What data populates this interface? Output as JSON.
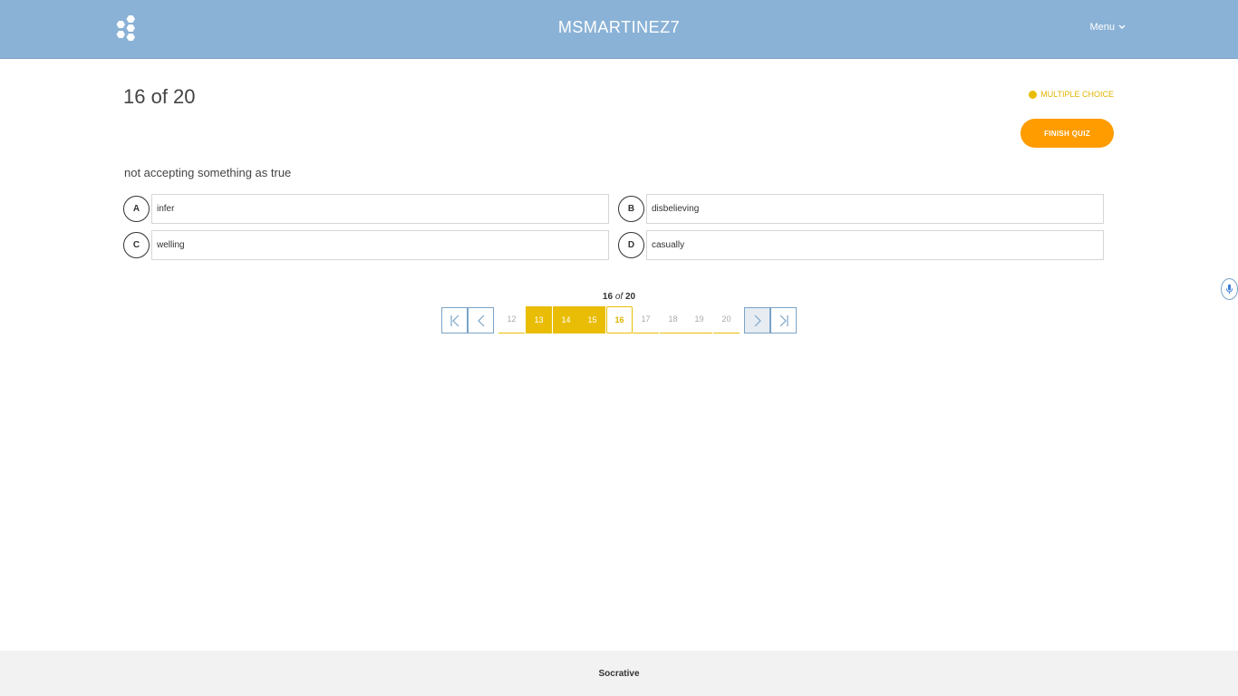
{
  "header": {
    "room_name": "MSMARTINEZ7",
    "menu_label": "Menu",
    "logo_icon": "socrative-hexagon-logo-icon"
  },
  "question": {
    "counter": "16 of 20",
    "type_label": "MULTIPLE CHOICE",
    "finish_label": "FINISH QUIZ",
    "prompt": "not accepting something as true",
    "choices": [
      {
        "letter": "A",
        "text": "infer"
      },
      {
        "letter": "B",
        "text": "disbelieving"
      },
      {
        "letter": "C",
        "text": "welling"
      },
      {
        "letter": "D",
        "text": "casually"
      }
    ]
  },
  "navigation": {
    "current": "16",
    "of_word": "of",
    "total": "20",
    "pages": [
      {
        "num": "12",
        "state": "unanswered"
      },
      {
        "num": "13",
        "state": "answered"
      },
      {
        "num": "14",
        "state": "answered"
      },
      {
        "num": "15",
        "state": "answered"
      },
      {
        "num": "16",
        "state": "current"
      },
      {
        "num": "17",
        "state": "unanswered"
      },
      {
        "num": "18",
        "state": "unanswered"
      },
      {
        "num": "19",
        "state": "unanswered"
      },
      {
        "num": "20",
        "state": "unanswered"
      }
    ],
    "icons": [
      "first-page-icon",
      "previous-page-icon",
      "next-page-icon",
      "last-page-icon"
    ]
  },
  "colors": {
    "header_bg": "#8ab2d6",
    "accent_yellow": "#e9bd06",
    "finish_orange": "#ff9c00"
  },
  "footer": {
    "brand": "Socrative"
  }
}
